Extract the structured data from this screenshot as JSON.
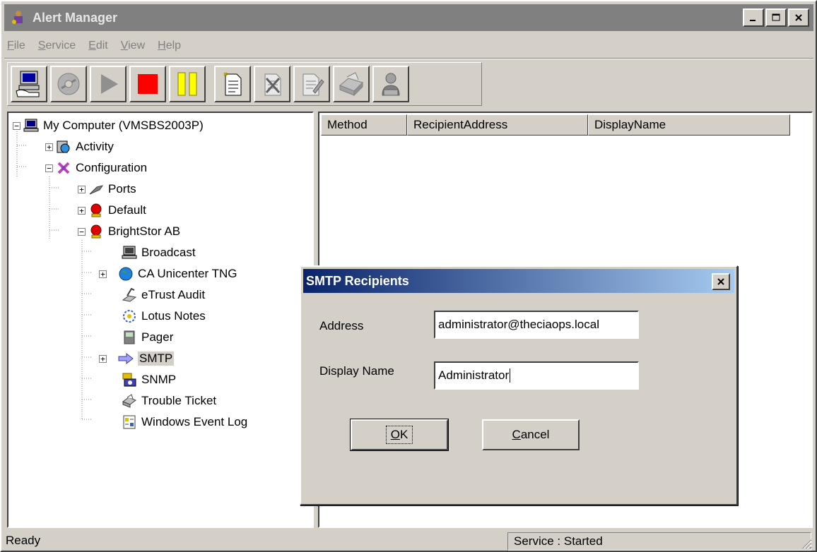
{
  "window": {
    "title": "Alert Manager"
  },
  "menu": {
    "items": [
      {
        "label": "File",
        "key": "F",
        "rest": "ile"
      },
      {
        "label": "Service",
        "key": "S",
        "rest": "ervice"
      },
      {
        "label": "Edit",
        "key": "E",
        "rest": "dit"
      },
      {
        "label": "View",
        "key": "V",
        "rest": "iew"
      },
      {
        "label": "Help",
        "key": "H",
        "rest": "elp"
      }
    ]
  },
  "toolbar": {
    "buttons": [
      {
        "name": "connect-computer",
        "icon": "computer-hand-icon"
      },
      {
        "name": "disabled-service",
        "icon": "disc-icon"
      },
      {
        "name": "start",
        "icon": "play-icon"
      },
      {
        "name": "stop",
        "icon": "stop-icon"
      },
      {
        "name": "pause",
        "icon": "pause-icon"
      },
      {
        "name": "new",
        "icon": "new-document-icon"
      },
      {
        "name": "delete",
        "icon": "delete-document-icon"
      },
      {
        "name": "properties",
        "icon": "edit-document-icon"
      },
      {
        "name": "print",
        "icon": "printer-icon"
      },
      {
        "name": "user",
        "icon": "user-icon"
      }
    ],
    "colors": {
      "stop": "#ff0000",
      "pause": "#ffff00"
    }
  },
  "tree": {
    "root": "My Computer (VMSBS2003P)",
    "activity": "Activity",
    "configuration": "Configuration",
    "ports": "Ports",
    "default": "Default",
    "brightstor": "BrightStor AB",
    "children": {
      "broadcast": "Broadcast",
      "unicenter": "CA Unicenter TNG",
      "etrust": "eTrust Audit",
      "lotus": "Lotus Notes",
      "pager": "Pager",
      "smtp": "SMTP",
      "snmp": "SNMP",
      "trouble": "Trouble Ticket",
      "eventlog": "Windows Event Log"
    }
  },
  "list": {
    "columns": [
      "Method",
      "RecipientAddress",
      "DisplayName"
    ]
  },
  "status": {
    "left": "Ready",
    "right": "Service : Started"
  },
  "dialog": {
    "title": "SMTP Recipients",
    "address_label": "Address",
    "address_value": "administrator@theciaops.local",
    "display_name_label": "Display Name",
    "display_name_value": "Administrator",
    "ok_key": "O",
    "ok_rest": "K",
    "cancel_key": "C",
    "cancel_rest": "ancel"
  }
}
